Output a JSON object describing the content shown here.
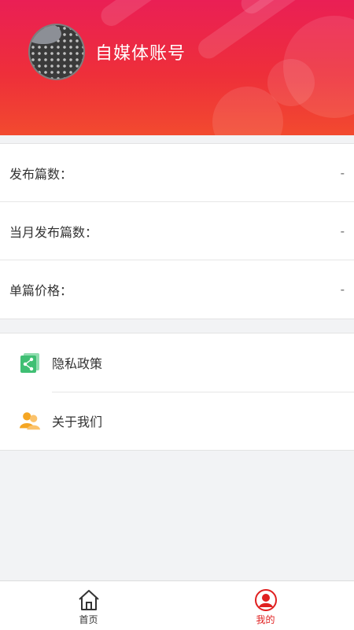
{
  "profile": {
    "account_name": "自媒体账号"
  },
  "stats": [
    {
      "label": "发布篇数：",
      "value": "-"
    },
    {
      "label": "当月发布篇数：",
      "value": "-"
    },
    {
      "label": "单篇价格：",
      "value": "-"
    }
  ],
  "menu": [
    {
      "label": "隐私政策",
      "icon": "share-icon",
      "color": "#3fbf73"
    },
    {
      "label": "关于我们",
      "icon": "users-icon",
      "color": "#f5a623"
    }
  ],
  "tabbar": {
    "home_label": "首页",
    "mine_label": "我的",
    "active_color": "#e02020"
  },
  "colors": {
    "header_start": "#ea1f55",
    "header_end": "#f24a2f"
  }
}
